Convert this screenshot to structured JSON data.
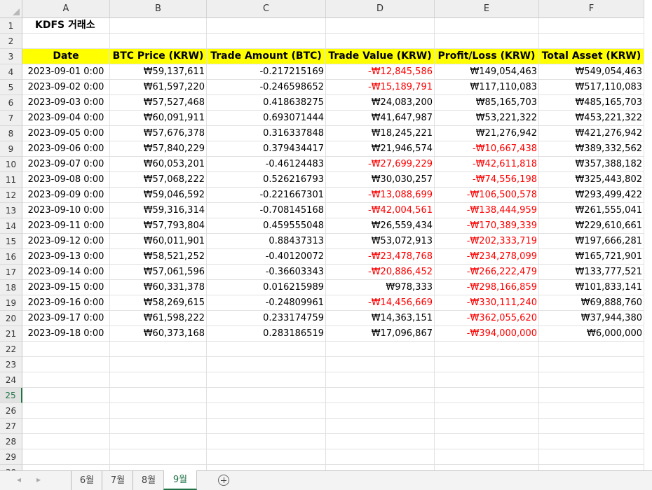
{
  "columns": [
    "A",
    "B",
    "C",
    "D",
    "E",
    "F"
  ],
  "title_cell": "KDFS 거래소",
  "headers": [
    "Date",
    "BTC Price (KRW)",
    "Trade Amount (BTC)",
    "Trade Value (KRW)",
    "Profit/Loss (KRW)",
    "Total Asset (KRW)"
  ],
  "rows": [
    {
      "date": "2023-09-01 0:00",
      "price": "₩59,137,611",
      "amount": "-0.217215169",
      "value": "-₩12,845,586",
      "value_neg": true,
      "pl": "₩149,054,463",
      "pl_neg": false,
      "asset": "₩549,054,463"
    },
    {
      "date": "2023-09-02 0:00",
      "price": "₩61,597,220",
      "amount": "-0.246598652",
      "value": "-₩15,189,791",
      "value_neg": true,
      "pl": "₩117,110,083",
      "pl_neg": false,
      "asset": "₩517,110,083"
    },
    {
      "date": "2023-09-03 0:00",
      "price": "₩57,527,468",
      "amount": "0.418638275",
      "value": "₩24,083,200",
      "value_neg": false,
      "pl": "₩85,165,703",
      "pl_neg": false,
      "asset": "₩485,165,703"
    },
    {
      "date": "2023-09-04 0:00",
      "price": "₩60,091,911",
      "amount": "0.693071444",
      "value": "₩41,647,987",
      "value_neg": false,
      "pl": "₩53,221,322",
      "pl_neg": false,
      "asset": "₩453,221,322"
    },
    {
      "date": "2023-09-05 0:00",
      "price": "₩57,676,378",
      "amount": "0.316337848",
      "value": "₩18,245,221",
      "value_neg": false,
      "pl": "₩21,276,942",
      "pl_neg": false,
      "asset": "₩421,276,942"
    },
    {
      "date": "2023-09-06 0:00",
      "price": "₩57,840,229",
      "amount": "0.379434417",
      "value": "₩21,946,574",
      "value_neg": false,
      "pl": "-₩10,667,438",
      "pl_neg": true,
      "asset": "₩389,332,562"
    },
    {
      "date": "2023-09-07 0:00",
      "price": "₩60,053,201",
      "amount": "-0.46124483",
      "value": "-₩27,699,229",
      "value_neg": true,
      "pl": "-₩42,611,818",
      "pl_neg": true,
      "asset": "₩357,388,182"
    },
    {
      "date": "2023-09-08 0:00",
      "price": "₩57,068,222",
      "amount": "0.526216793",
      "value": "₩30,030,257",
      "value_neg": false,
      "pl": "-₩74,556,198",
      "pl_neg": true,
      "asset": "₩325,443,802"
    },
    {
      "date": "2023-09-09 0:00",
      "price": "₩59,046,592",
      "amount": "-0.221667301",
      "value": "-₩13,088,699",
      "value_neg": true,
      "pl": "-₩106,500,578",
      "pl_neg": true,
      "asset": "₩293,499,422"
    },
    {
      "date": "2023-09-10 0:00",
      "price": "₩59,316,314",
      "amount": "-0.708145168",
      "value": "-₩42,004,561",
      "value_neg": true,
      "pl": "-₩138,444,959",
      "pl_neg": true,
      "asset": "₩261,555,041"
    },
    {
      "date": "2023-09-11 0:00",
      "price": "₩57,793,804",
      "amount": "0.459555048",
      "value": "₩26,559,434",
      "value_neg": false,
      "pl": "-₩170,389,339",
      "pl_neg": true,
      "asset": "₩229,610,661"
    },
    {
      "date": "2023-09-12 0:00",
      "price": "₩60,011,901",
      "amount": "0.88437313",
      "value": "₩53,072,913",
      "value_neg": false,
      "pl": "-₩202,333,719",
      "pl_neg": true,
      "asset": "₩197,666,281"
    },
    {
      "date": "2023-09-13 0:00",
      "price": "₩58,521,252",
      "amount": "-0.40120072",
      "value": "-₩23,478,768",
      "value_neg": true,
      "pl": "-₩234,278,099",
      "pl_neg": true,
      "asset": "₩165,721,901"
    },
    {
      "date": "2023-09-14 0:00",
      "price": "₩57,061,596",
      "amount": "-0.36603343",
      "value": "-₩20,886,452",
      "value_neg": true,
      "pl": "-₩266,222,479",
      "pl_neg": true,
      "asset": "₩133,777,521"
    },
    {
      "date": "2023-09-15 0:00",
      "price": "₩60,331,378",
      "amount": "0.016215989",
      "value": "₩978,333",
      "value_neg": false,
      "pl": "-₩298,166,859",
      "pl_neg": true,
      "asset": "₩101,833,141"
    },
    {
      "date": "2023-09-16 0:00",
      "price": "₩58,269,615",
      "amount": "-0.24809961",
      "value": "-₩14,456,669",
      "value_neg": true,
      "pl": "-₩330,111,240",
      "pl_neg": true,
      "asset": "₩69,888,760"
    },
    {
      "date": "2023-09-17 0:00",
      "price": "₩61,598,222",
      "amount": "0.233174759",
      "value": "₩14,363,151",
      "value_neg": false,
      "pl": "-₩362,055,620",
      "pl_neg": true,
      "asset": "₩37,944,380"
    },
    {
      "date": "2023-09-18 0:00",
      "price": "₩60,373,168",
      "amount": "0.283186519",
      "value": "₩17,096,867",
      "value_neg": false,
      "pl": "-₩394,000,000",
      "pl_neg": true,
      "asset": "₩6,000,000"
    }
  ],
  "total_rows": 30,
  "active_row": 25,
  "colors": {
    "header_fill": "#ffff00",
    "negative": "#ff0000",
    "accent": "#1f7244"
  },
  "sheet_tabs": [
    {
      "label": "6월",
      "active": false
    },
    {
      "label": "7월",
      "active": false
    },
    {
      "label": "8월",
      "active": false
    },
    {
      "label": "9월",
      "active": true
    }
  ],
  "icons": {
    "prev": "prev-sheet-icon",
    "next": "next-sheet-icon",
    "add": "add-sheet-icon"
  }
}
